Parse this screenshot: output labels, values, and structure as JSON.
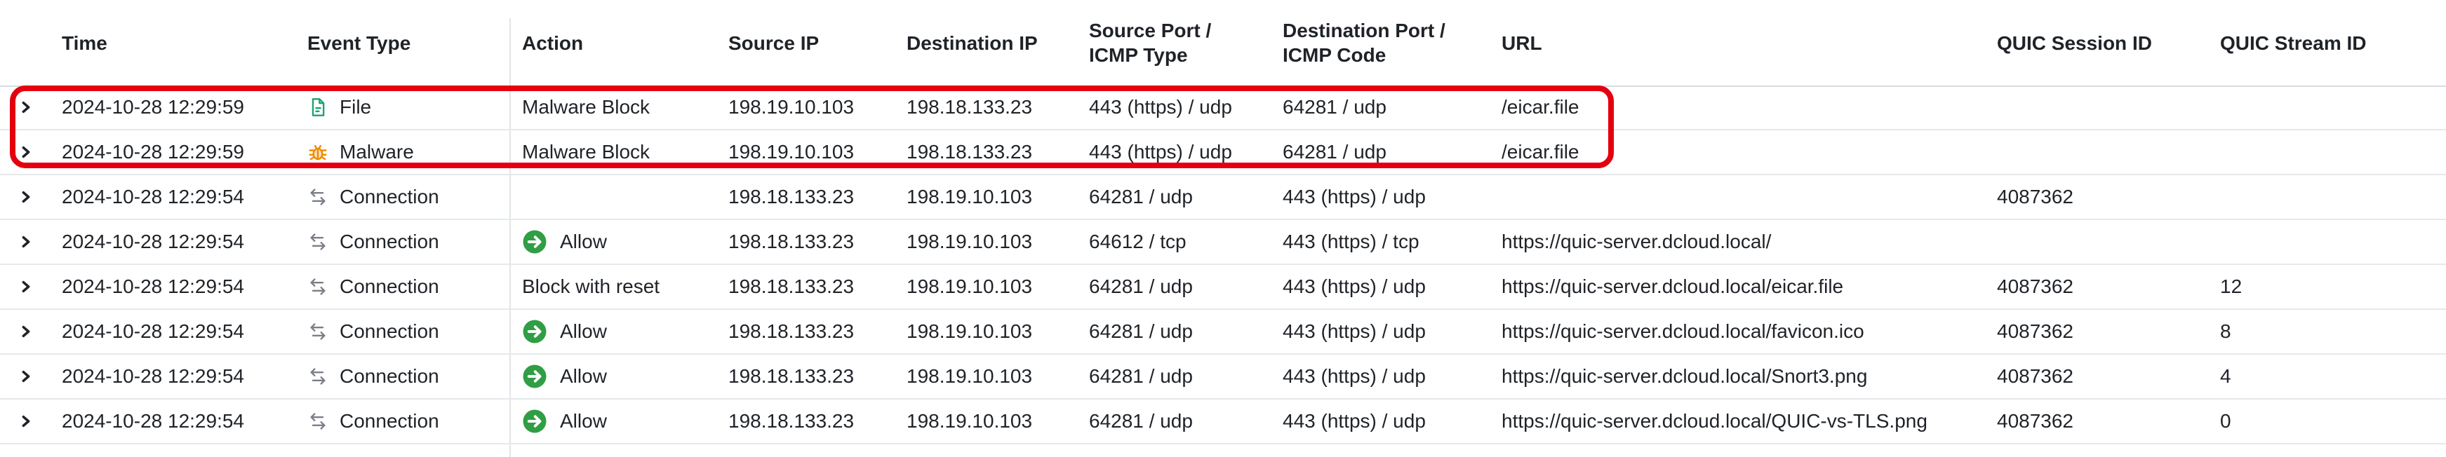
{
  "columns": {
    "time": "Time",
    "event_type": "Event Type",
    "action": "Action",
    "source_ip": "Source IP",
    "destination_ip": "Destination IP",
    "source_port": "Source Port /\nICMP Type",
    "destination_port": "Destination Port /\nICMP Code",
    "url": "URL",
    "quic_session_id": "QUIC Session ID",
    "quic_stream_id": "QUIC Stream ID"
  },
  "colors": {
    "highlight": "#e4000f",
    "allow": "#2f9e44",
    "file_icon": "#1aa36f",
    "malware_icon": "#f08c00",
    "connection_icon": "#7a7f87"
  },
  "rows": [
    {
      "time": "2024-10-28 12:29:59",
      "event_icon": "file-icon",
      "event_type": "File",
      "action_icon": "",
      "action": "Malware Block",
      "source_ip": "198.19.10.103",
      "destination_ip": "198.18.133.23",
      "source_port": "443 (https) / udp",
      "destination_port": "64281 / udp",
      "url": "/eicar.file",
      "quic_session_id": "",
      "quic_stream_id": "",
      "highlighted": true
    },
    {
      "time": "2024-10-28 12:29:59",
      "event_icon": "bug-icon",
      "event_type": "Malware",
      "action_icon": "",
      "action": "Malware Block",
      "source_ip": "198.19.10.103",
      "destination_ip": "198.18.133.23",
      "source_port": "443 (https) / udp",
      "destination_port": "64281 / udp",
      "url": "/eicar.file",
      "quic_session_id": "",
      "quic_stream_id": "",
      "highlighted": true
    },
    {
      "time": "2024-10-28 12:29:54",
      "event_icon": "connection-icon",
      "event_type": "Connection",
      "action_icon": "",
      "action": "",
      "source_ip": "198.18.133.23",
      "destination_ip": "198.19.10.103",
      "source_port": "64281 / udp",
      "destination_port": "443 (https) / udp",
      "url": "",
      "quic_session_id": "4087362",
      "quic_stream_id": ""
    },
    {
      "time": "2024-10-28 12:29:54",
      "event_icon": "connection-icon",
      "event_type": "Connection",
      "action_icon": "allow-icon",
      "action": "Allow",
      "source_ip": "198.18.133.23",
      "destination_ip": "198.19.10.103",
      "source_port": "64612 / tcp",
      "destination_port": "443 (https) / tcp",
      "url": "https://quic-server.dcloud.local/",
      "quic_session_id": "",
      "quic_stream_id": ""
    },
    {
      "time": "2024-10-28 12:29:54",
      "event_icon": "connection-icon",
      "event_type": "Connection",
      "action_icon": "",
      "action": "Block with reset",
      "source_ip": "198.18.133.23",
      "destination_ip": "198.19.10.103",
      "source_port": "64281 / udp",
      "destination_port": "443 (https) / udp",
      "url": "https://quic-server.dcloud.local/eicar.file",
      "quic_session_id": "4087362",
      "quic_stream_id": "12"
    },
    {
      "time": "2024-10-28 12:29:54",
      "event_icon": "connection-icon",
      "event_type": "Connection",
      "action_icon": "allow-icon",
      "action": "Allow",
      "source_ip": "198.18.133.23",
      "destination_ip": "198.19.10.103",
      "source_port": "64281 / udp",
      "destination_port": "443 (https) / udp",
      "url": "https://quic-server.dcloud.local/favicon.ico",
      "quic_session_id": "4087362",
      "quic_stream_id": "8"
    },
    {
      "time": "2024-10-28 12:29:54",
      "event_icon": "connection-icon",
      "event_type": "Connection",
      "action_icon": "allow-icon",
      "action": "Allow",
      "source_ip": "198.18.133.23",
      "destination_ip": "198.19.10.103",
      "source_port": "64281 / udp",
      "destination_port": "443 (https) / udp",
      "url": "https://quic-server.dcloud.local/Snort3.png",
      "quic_session_id": "4087362",
      "quic_stream_id": "4"
    },
    {
      "time": "2024-10-28 12:29:54",
      "event_icon": "connection-icon",
      "event_type": "Connection",
      "action_icon": "allow-icon",
      "action": "Allow",
      "source_ip": "198.18.133.23",
      "destination_ip": "198.19.10.103",
      "source_port": "64281 / udp",
      "destination_port": "443 (https) / udp",
      "url": "https://quic-server.dcloud.local/QUIC-vs-TLS.png",
      "quic_session_id": "4087362",
      "quic_stream_id": "0"
    }
  ]
}
